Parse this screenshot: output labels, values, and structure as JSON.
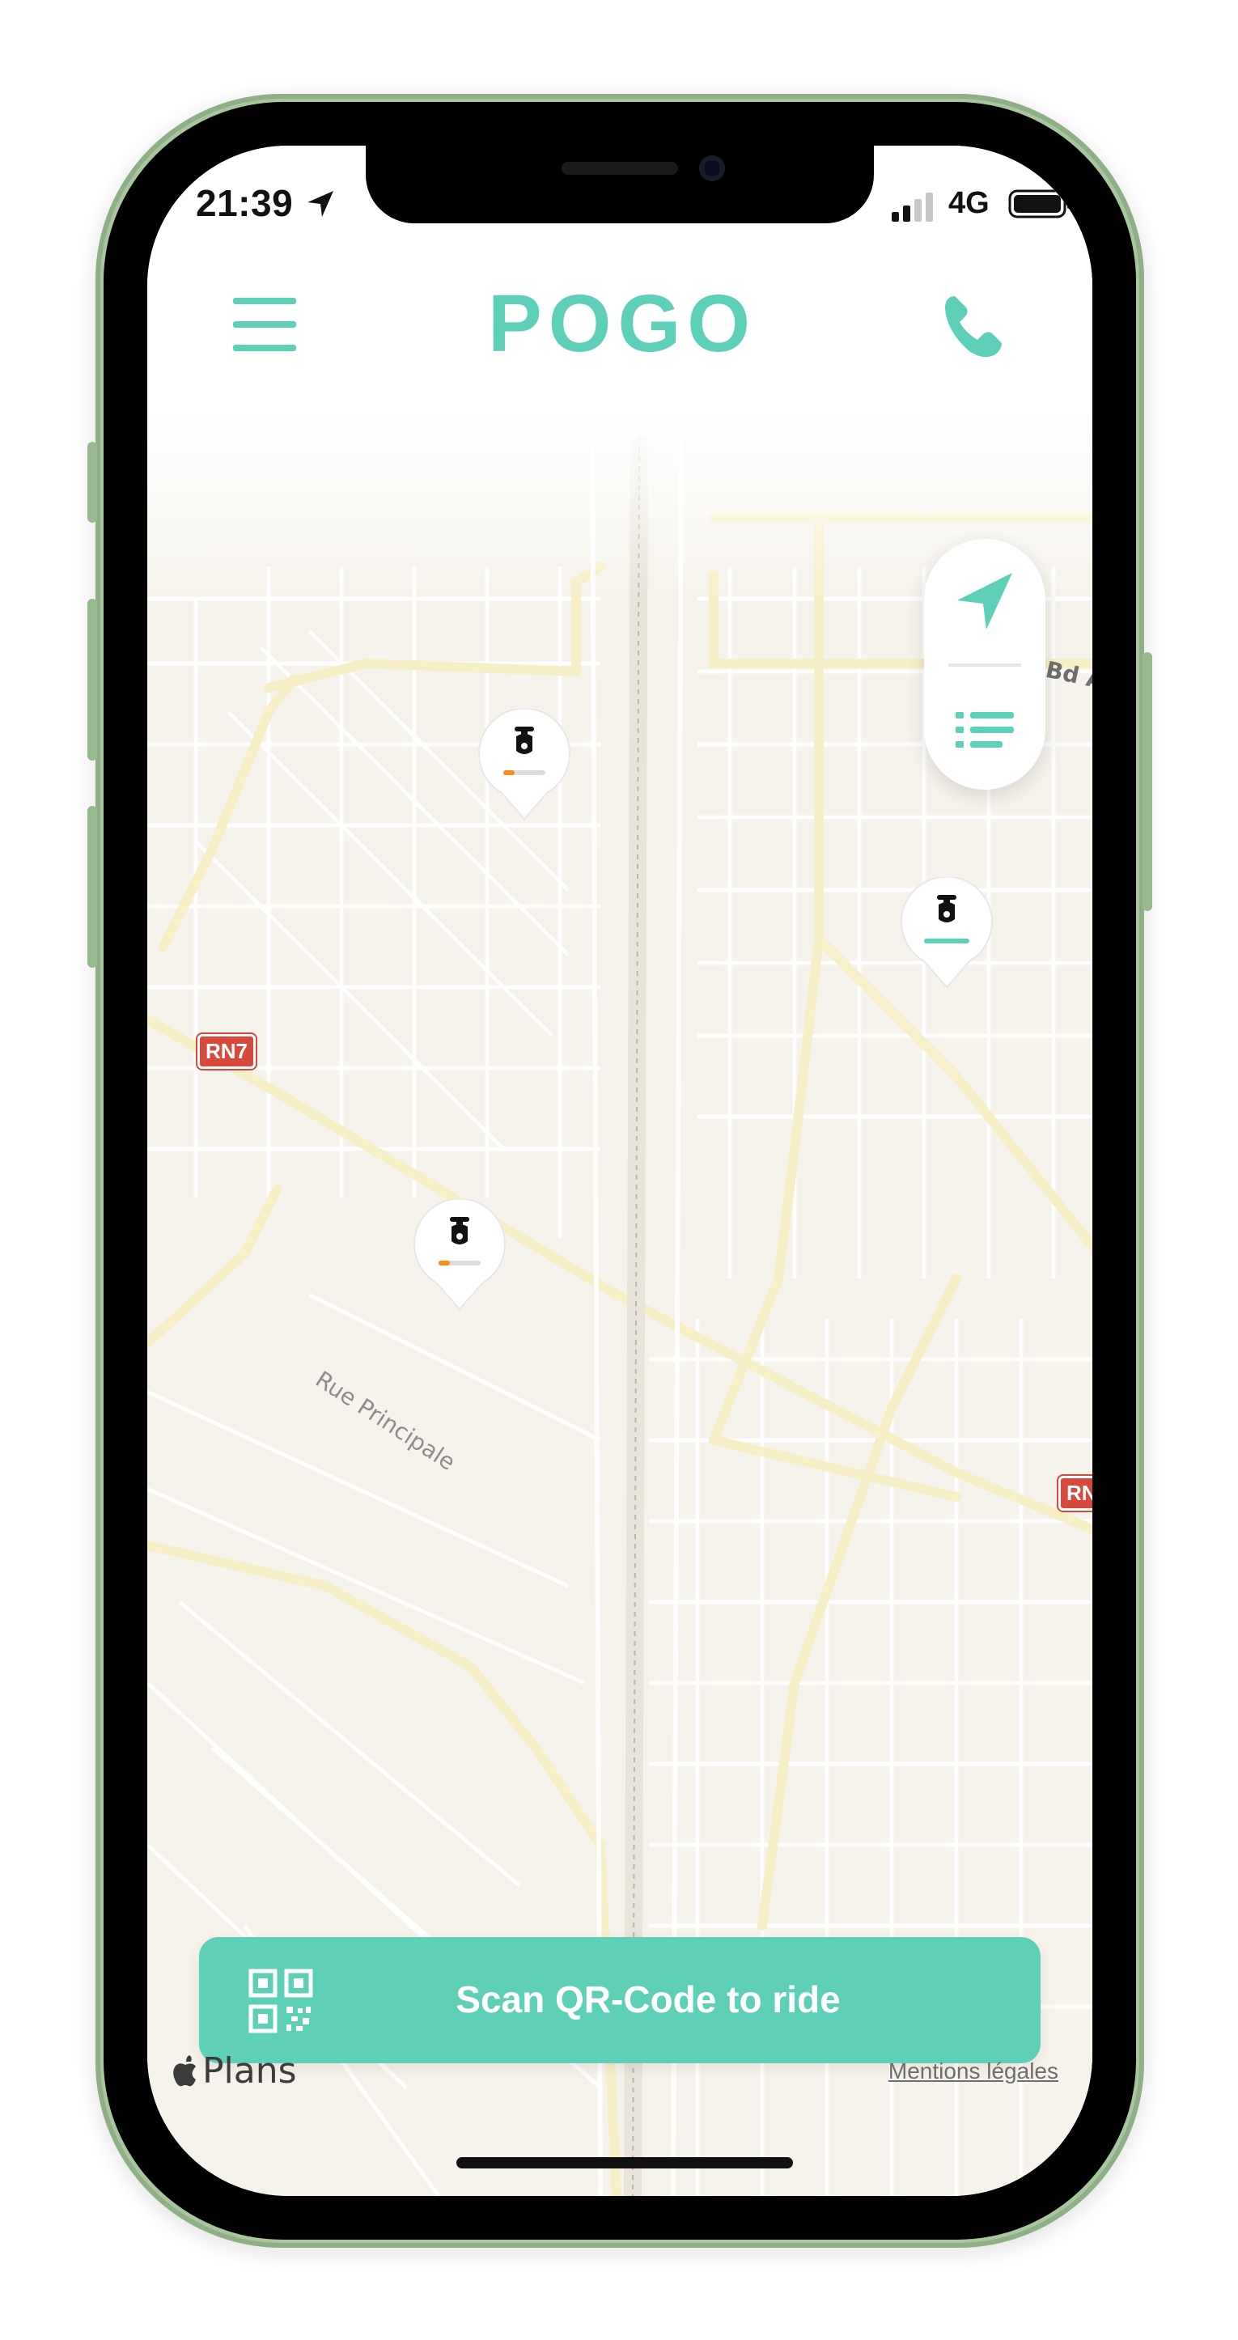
{
  "status_bar": {
    "time": "21:39",
    "network": "4G"
  },
  "header": {
    "logo_text": "POGO",
    "brand_color": "#5ecfb8"
  },
  "map": {
    "labels": {
      "street": "Rue Principale",
      "boulevard": "Bd A"
    },
    "road_shields": [
      "RN7",
      "RN"
    ],
    "scooters": [
      {
        "battery_level": "low",
        "battery_color": "#ff8c1a"
      },
      {
        "battery_level": "full",
        "battery_color": "#5ecfb8"
      },
      {
        "battery_level": "low",
        "battery_color": "#ff8c1a"
      }
    ],
    "attribution": "Plans"
  },
  "actions": {
    "scan_button_label": "Scan QR-Code to ride",
    "legal_link": "Mentions légales"
  },
  "icons": {
    "menu": "hamburger-icon",
    "call": "phone-icon",
    "locate": "navigation-arrow-icon",
    "list": "list-icon",
    "scan": "qr-code-icon"
  }
}
